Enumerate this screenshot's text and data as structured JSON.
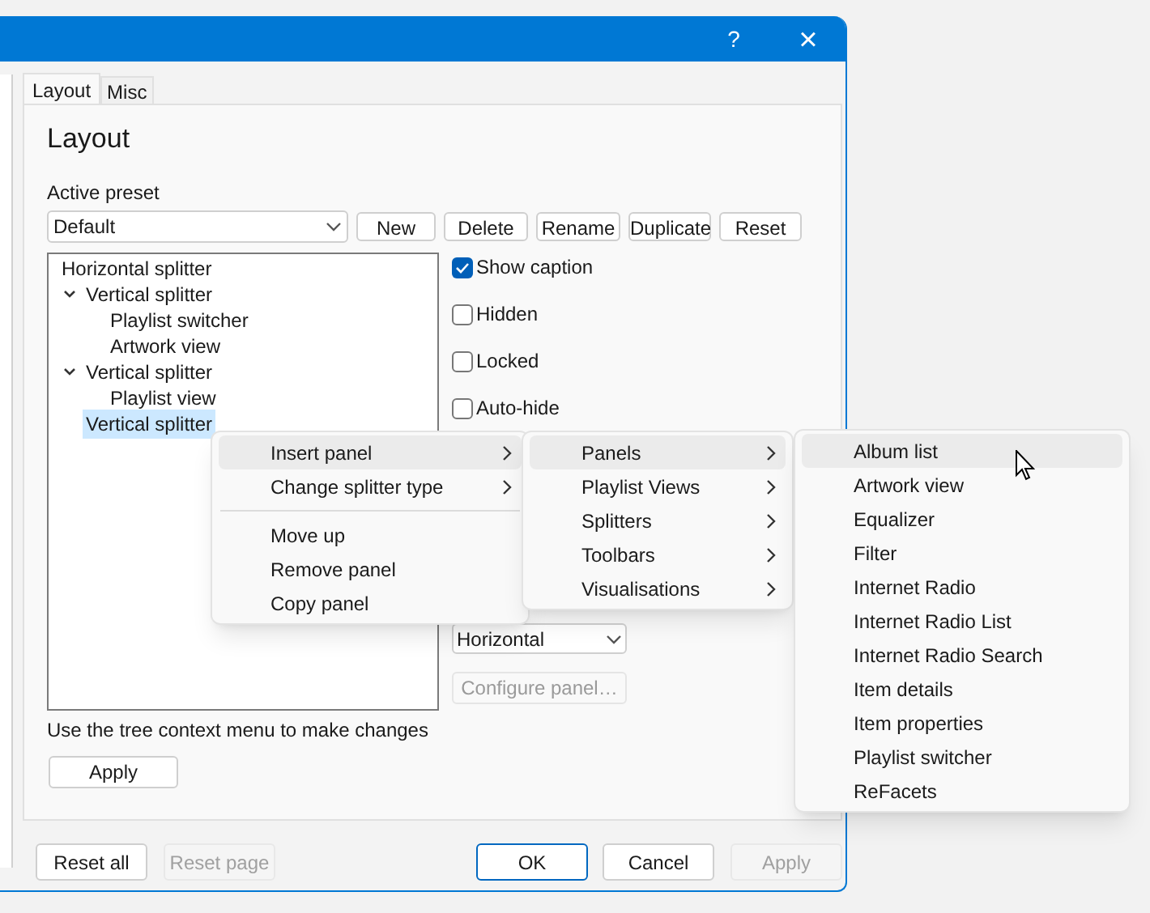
{
  "title_bar": {
    "buttons": [
      "?",
      "×"
    ]
  },
  "tabs": [
    {
      "label": "Layout",
      "selected": true
    },
    {
      "label": "Misc",
      "selected": false
    }
  ],
  "page_title": "Layout",
  "preset": {
    "label": "Active preset",
    "value": "Default",
    "buttons": [
      "New",
      "Delete",
      "Rename",
      "Duplicate",
      "Reset"
    ]
  },
  "tree": [
    {
      "label": "Horizontal splitter",
      "selected": false,
      "children": [
        {
          "label": "Vertical splitter",
          "selected": false,
          "expanded": true,
          "children": [
            {
              "label": "Playlist switcher",
              "selected": false
            },
            {
              "label": "Artwork view",
              "selected": false
            }
          ]
        },
        {
          "label": "Vertical splitter",
          "selected": false,
          "expanded": true,
          "children": [
            {
              "label": "Playlist view",
              "selected": false
            }
          ]
        },
        {
          "label": "Vertical splitter",
          "selected": true
        }
      ]
    }
  ],
  "options": [
    {
      "label": "Show caption",
      "checked": true
    },
    {
      "label": "Hidden",
      "checked": false
    },
    {
      "label": "Locked",
      "checked": false
    },
    {
      "label": "Auto-hide",
      "checked": false
    }
  ],
  "orientation_select": {
    "value": "Horizontal"
  },
  "configure_button": {
    "label": "Configure panel…",
    "disabled": true
  },
  "hint": "Use the tree context menu to make changes",
  "apply_button": {
    "label": "Apply"
  },
  "footer_buttons": [
    {
      "label": "Reset all",
      "disabled": false,
      "default": false
    },
    {
      "label": "Reset page",
      "disabled": true,
      "default": false
    },
    {
      "label": "OK",
      "disabled": false,
      "default": true
    },
    {
      "label": "Cancel",
      "disabled": false,
      "default": false
    },
    {
      "label": "Apply",
      "disabled": true,
      "default": false
    }
  ],
  "menus": [
    {
      "items": [
        {
          "kind": "item",
          "label": "Insert panel",
          "submenu": true,
          "highlighted": true
        },
        {
          "kind": "item",
          "label": "Change splitter type",
          "submenu": true,
          "highlighted": false
        },
        {
          "kind": "separator"
        },
        {
          "kind": "item",
          "label": "Move up",
          "submenu": false,
          "highlighted": false
        },
        {
          "kind": "item",
          "label": "Remove panel",
          "submenu": false,
          "highlighted": false
        },
        {
          "kind": "item",
          "label": "Copy panel",
          "submenu": false,
          "highlighted": false
        }
      ]
    },
    {
      "items": [
        {
          "kind": "item",
          "label": "Panels",
          "submenu": true,
          "highlighted": true
        },
        {
          "kind": "item",
          "label": "Playlist Views",
          "submenu": true,
          "highlighted": false
        },
        {
          "kind": "item",
          "label": "Splitters",
          "submenu": true,
          "highlighted": false
        },
        {
          "kind": "item",
          "label": "Toolbars",
          "submenu": true,
          "highlighted": false
        },
        {
          "kind": "item",
          "label": "Visualisations",
          "submenu": true,
          "highlighted": false
        }
      ]
    },
    {
      "items": [
        {
          "kind": "item",
          "label": "Album list",
          "submenu": false,
          "highlighted": true
        },
        {
          "kind": "item",
          "label": "Artwork view",
          "submenu": false,
          "highlighted": false
        },
        {
          "kind": "item",
          "label": "Equalizer",
          "submenu": false,
          "highlighted": false
        },
        {
          "kind": "item",
          "label": "Filter",
          "submenu": false,
          "highlighted": false
        },
        {
          "kind": "item",
          "label": "Internet Radio",
          "submenu": false,
          "highlighted": false
        },
        {
          "kind": "item",
          "label": "Internet Radio List",
          "submenu": false,
          "highlighted": false
        },
        {
          "kind": "item",
          "label": "Internet Radio Search",
          "submenu": false,
          "highlighted": false
        },
        {
          "kind": "item",
          "label": "Item details",
          "submenu": false,
          "highlighted": false
        },
        {
          "kind": "item",
          "label": "Item properties",
          "submenu": false,
          "highlighted": false
        },
        {
          "kind": "item",
          "label": "Playlist switcher",
          "submenu": false,
          "highlighted": false
        },
        {
          "kind": "item",
          "label": "ReFacets",
          "submenu": false,
          "highlighted": false
        }
      ]
    }
  ]
}
